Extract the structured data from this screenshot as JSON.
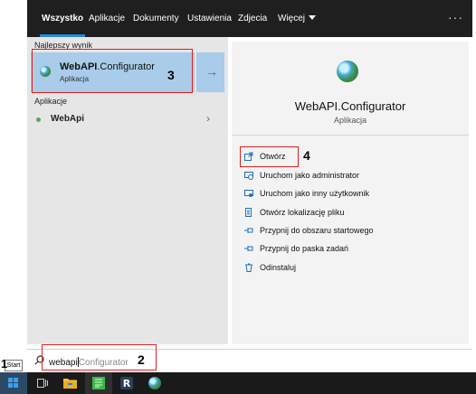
{
  "top_nav": {
    "tabs": [
      "Wszystko",
      "Aplikacje",
      "Dokumenty",
      "Ustawienia",
      "Zdjecia",
      "Więcej"
    ],
    "more_label": "···"
  },
  "left_pane": {
    "best_match_header": "Najlepszy wynik",
    "best_match": {
      "title_bold": "WebAPI",
      "title_rest": ".Configurator",
      "subtitle": "Aplikacja",
      "icon": "globe-icon"
    },
    "apps_header": "Aplikacje",
    "apps": [
      {
        "label": "WebApi",
        "icon": "green-dot-icon"
      }
    ]
  },
  "right_pane": {
    "app_title": "WebAPI.Configurator",
    "app_subtitle": "Aplikacja",
    "actions": [
      {
        "label": "Otwórz",
        "icon": "open-icon"
      },
      {
        "label": "Uruchom jako administrator",
        "icon": "run-as-admin-icon"
      },
      {
        "label": "Uruchom jako inny użytkownik",
        "icon": "run-as-other-user-icon"
      },
      {
        "label": "Otwórz lokalizację pliku",
        "icon": "open-file-location-icon"
      },
      {
        "label": "Przypnij do obszaru startowego",
        "icon": "pin-start-icon"
      },
      {
        "label": "Przypnij do paska zadań",
        "icon": "pin-taskbar-icon"
      },
      {
        "label": "Odinstaluj",
        "icon": "uninstall-icon"
      }
    ]
  },
  "search": {
    "typed": "webapi",
    "suggestion": "Configurator"
  },
  "taskbar": {
    "start_tooltip": "Start",
    "icons": [
      "windows-logo-icon",
      "task-view-icon",
      "file-explorer-icon",
      "green-app-icon",
      "r-app-icon",
      "globe-app-icon"
    ]
  },
  "annotations": [
    "1",
    "2",
    "3",
    "4"
  ],
  "colors": {
    "accent": "#2b88d8",
    "selection": "#a8cce9",
    "annotation": "#e02020",
    "top_bar": "#1f1f1f"
  }
}
